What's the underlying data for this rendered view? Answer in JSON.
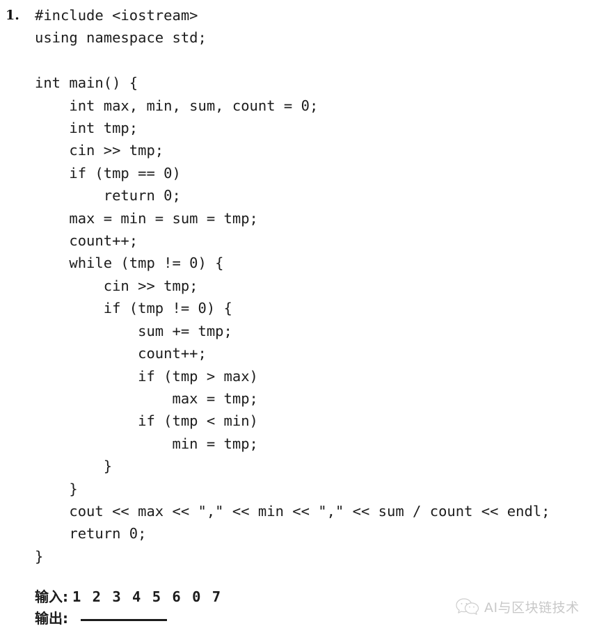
{
  "question": {
    "marker": "1.",
    "code": "#include <iostream>\nusing namespace std;\n\nint main() {\n    int max, min, sum, count = 0;\n    int tmp;\n    cin >> tmp;\n    if (tmp == 0)\n        return 0;\n    max = min = sum = tmp;\n    count++;\n    while (tmp != 0) {\n        cin >> tmp;\n        if (tmp != 0) {\n            sum += tmp;\n            count++;\n            if (tmp > max)\n                max = tmp;\n            if (tmp < min)\n                min = tmp;\n        }\n    }\n    cout << max << \",\" << min << \",\" << sum / count << endl;\n    return 0;\n}",
    "code_lines": [
      "#include <iostream>",
      "using namespace std;",
      "",
      "int main() {",
      "    int max, min, sum, count = 0;",
      "    int tmp;",
      "    cin >> tmp;",
      "    if (tmp == 0)",
      "        return 0;",
      "    max = min = sum = tmp;",
      "    count++;",
      "    while (tmp != 0) {",
      "        cin >> tmp;",
      "        if (tmp != 0) {",
      "            sum += tmp;",
      "            count++;",
      "            if (tmp > max)",
      "                max = tmp;",
      "            if (tmp < min)",
      "                min = tmp;",
      "        }",
      "    }",
      "    cout << max << \",\" << min << \",\" << sum / count << endl;",
      "    return 0;",
      "}"
    ],
    "language": "cpp"
  },
  "io": {
    "input_label": "输入:",
    "input_value": "1 2 3 4 5 6 0 7",
    "output_label": "输出:",
    "output_value": ""
  },
  "watermark": {
    "icon": "wechat-icon",
    "label": "AI与区块链技术"
  },
  "colors": {
    "background": "#ffffff",
    "text": "#1c1c1c",
    "marker": "#111111",
    "watermark": "#7d7d7d"
  }
}
